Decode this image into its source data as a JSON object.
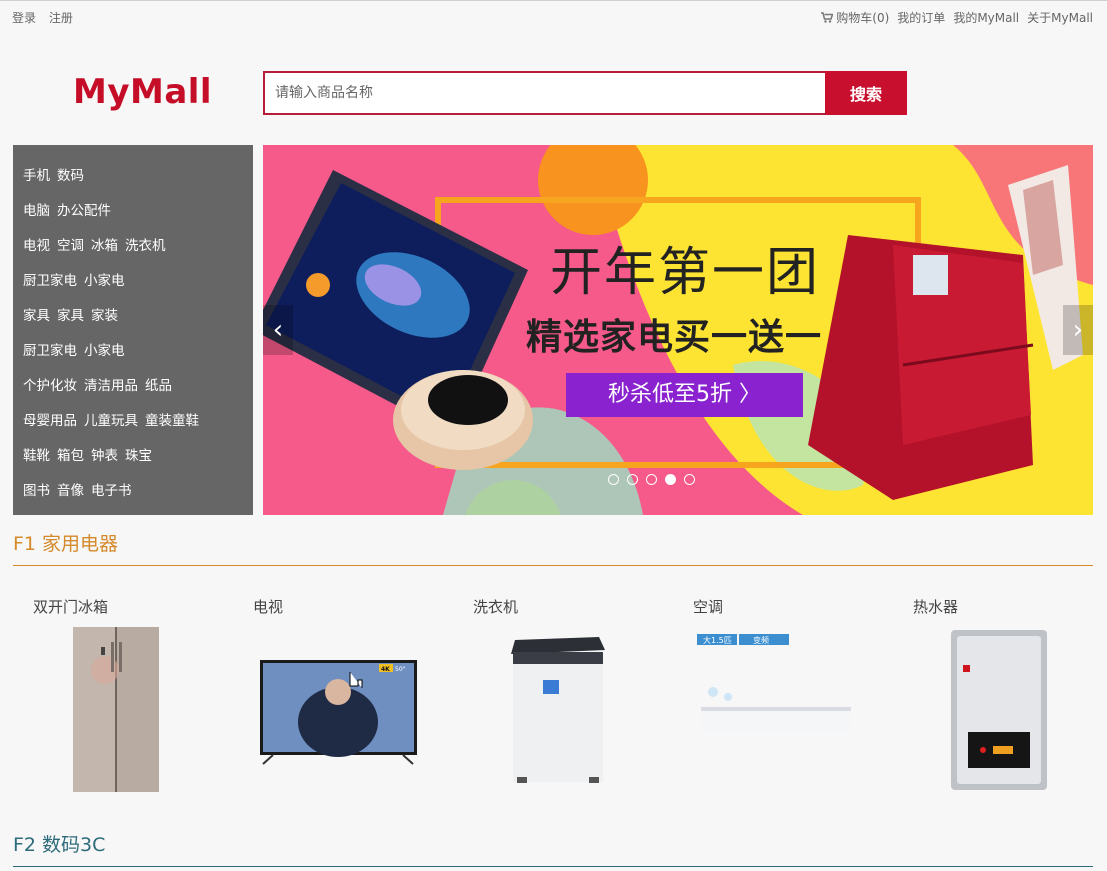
{
  "topbar": {
    "login": "登录",
    "register": "注册",
    "cart": "购物车(0)",
    "orders": "我的订单",
    "my_mall": "我的MyMall",
    "about": "关于MyMall"
  },
  "header": {
    "logo": "MyMall",
    "search_placeholder": "请输入商品名称",
    "search_button": "搜索"
  },
  "categories": [
    [
      "手机",
      "数码"
    ],
    [
      "电脑",
      "办公配件"
    ],
    [
      "电视",
      "空调",
      "冰箱",
      "洗衣机"
    ],
    [
      "厨卫家电",
      "小家电"
    ],
    [
      "家具",
      "家具",
      "家装"
    ],
    [
      "厨卫家电",
      "小家电"
    ],
    [
      "个护化妆",
      "清洁用品",
      "纸品"
    ],
    [
      "母婴用品",
      "儿童玩具",
      "童装童鞋"
    ],
    [
      "鞋靴",
      "箱包",
      "钟表",
      "珠宝"
    ],
    [
      "图书",
      "音像",
      "电子书"
    ]
  ],
  "banner": {
    "headline": "开年第一团",
    "subheadline": "精选家电买一送一",
    "promo": "秒杀低至5折 〉",
    "slide_count": 5,
    "active_slide": 4,
    "colors": {
      "bg": "#f65a8a",
      "yellow": "#fde433",
      "purple": "#8a23cf",
      "fridge": "#b3122a"
    }
  },
  "floors": [
    {
      "title": "F1 家用电器",
      "color": "#d4892a",
      "products": [
        "双开门冰箱",
        "电视",
        "洗衣机",
        "空调",
        "热水器"
      ]
    },
    {
      "title": "F2 数码3C",
      "color": "#2e6b7a"
    }
  ],
  "tv_badge": "4K",
  "tv_size": "50\"",
  "ac_tags": [
    "大1.5匹",
    "变频"
  ]
}
